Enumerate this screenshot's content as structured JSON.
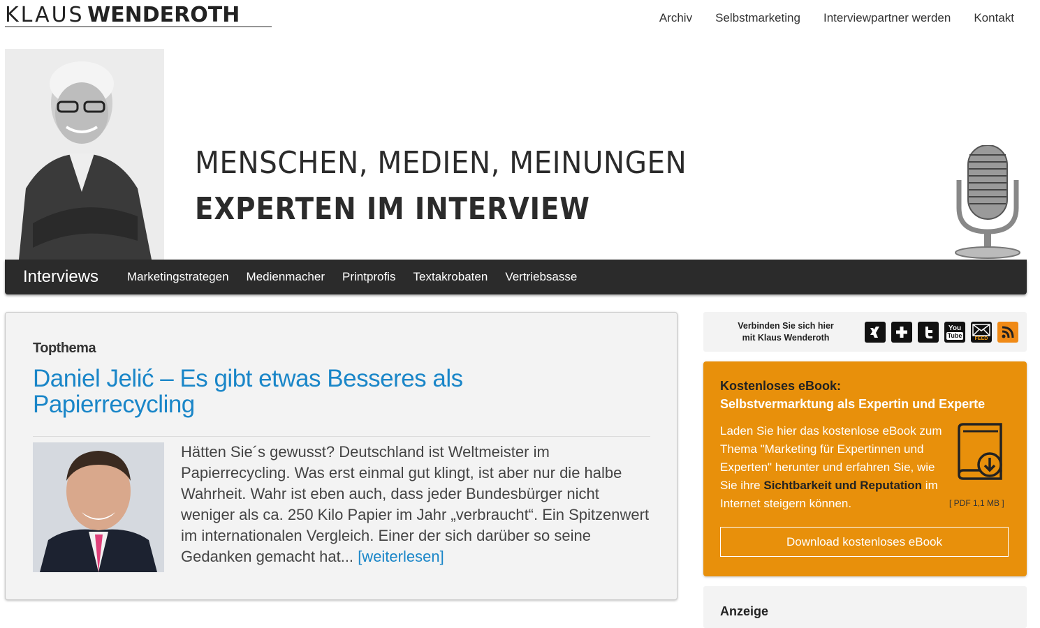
{
  "header": {
    "logo_first": "KLAUS",
    "logo_last": "WENDEROTH",
    "nav": [
      "Archiv",
      "Selbstmarketing",
      "Interviewpartner werden",
      "Kontakt"
    ]
  },
  "hero": {
    "headline": "MENSCHEN, MEDIEN, MEINUNGEN",
    "subline": "EXPERTEN  IM  INTERVIEW",
    "portrait_icon": "person-portrait-icon",
    "mic_icon": "microphone-icon"
  },
  "catbar": {
    "brand": "Interviews",
    "items": [
      "Marketingstrategen",
      "Medienmacher",
      "Printprofis",
      "Textakrobaten",
      "Vertriebsasse"
    ]
  },
  "article": {
    "kicker": "Topthema",
    "title": "Daniel Jelić – Es gibt etwas Besseres als Papierrecycling",
    "excerpt": "Hätten Sie´s gewusst? Deutschland ist Weltmeister im Papierrecycling. Was erst einmal gut klingt, ist aber nur die halbe Wahrheit. Wahr ist eben auch, dass jeder Bundesbürger nicht weniger als ca. 250 Kilo Papier im Jahr „verbraucht“. Ein Spitzenwert im internationalen Vergleich. Einer der sich darüber so seine Gedanken gemacht hat...",
    "more": "[weiterlesen]"
  },
  "connect": {
    "line1": "Verbinden Sie sich hier",
    "line2": "mit Klaus Wenderoth",
    "icons": [
      "xing-icon",
      "google-plus-icon",
      "twitter-icon",
      "youtube-icon",
      "email-feed-icon",
      "rss-icon"
    ]
  },
  "ebook": {
    "title1": "Kostenloses eBook:",
    "title2": "Selbstvermarktung als Expertin und Experte",
    "body_a": "Laden Sie hier das kostenlose eBook zum Thema \"Marketing für Expertinnen und Experten\" herunter und erfahren Sie, wie Sie ihre ",
    "body_b": "Sichtbarkeit und Reputation",
    "body_c": " im Internet steigern können.",
    "meta": "[ PDF 1,1 MB ]",
    "button": "Download kostenloses eBook",
    "book_icon": "ebook-download-icon"
  },
  "ad": {
    "label": "Anzeige"
  },
  "colors": {
    "accent_blue": "#1a86c8",
    "ebook_orange": "#e8900b",
    "bar_dark": "#2b2b2b"
  }
}
